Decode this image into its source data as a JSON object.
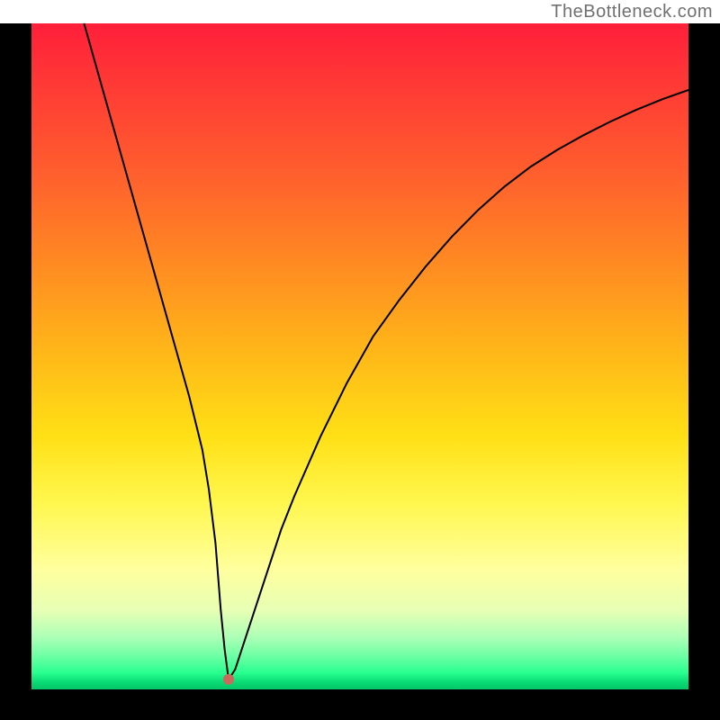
{
  "watermark": "TheBottleneck.com",
  "chart_data": {
    "type": "line",
    "title": "",
    "xlabel": "",
    "ylabel": "",
    "xlim": [
      0,
      100
    ],
    "ylim": [
      0,
      100
    ],
    "grid": false,
    "legend": false,
    "series": [
      {
        "name": "bottleneck-curve",
        "x": [
          8,
          10,
          12,
          14,
          16,
          18,
          20,
          22,
          24,
          26,
          27,
          28,
          28.8,
          29.4,
          30,
          31,
          32,
          34,
          36,
          38,
          40,
          44,
          48,
          52,
          56,
          60,
          64,
          68,
          72,
          76,
          80,
          84,
          88,
          92,
          96,
          100
        ],
        "y": [
          100,
          93,
          86,
          79,
          72,
          65,
          58,
          51,
          44,
          36,
          30,
          22,
          12,
          6,
          1.5,
          3,
          6,
          12,
          18,
          24,
          29,
          38,
          46,
          53,
          58.5,
          63.5,
          68,
          72,
          75.5,
          78.5,
          81,
          83.2,
          85.2,
          87,
          88.6,
          90
        ]
      }
    ],
    "marker": {
      "name": "min-point",
      "x": 30,
      "y": 1.5
    },
    "background_gradient": {
      "top": "#ff1f3a",
      "middle": "#ffe016",
      "bottom": "#06c768"
    }
  }
}
